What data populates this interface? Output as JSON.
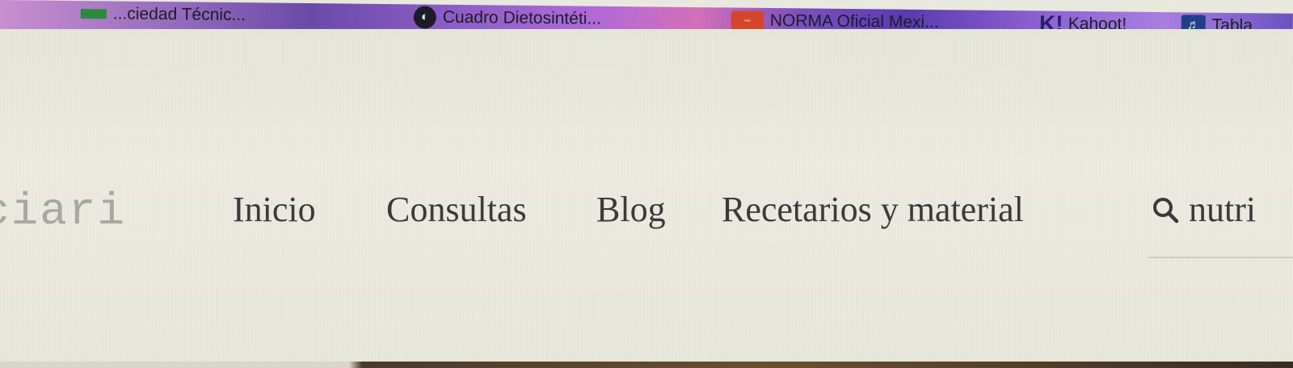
{
  "bookmarks": [
    {
      "label": "...ciedad Técnic...",
      "icon": "spreadsheet-icon"
    },
    {
      "label": "Cuadro Dietosintéti...",
      "icon": "circle-logo-icon"
    },
    {
      "label": "NORMA Oficial Mexi...",
      "icon": "norma-icon"
    },
    {
      "label": "Kahoot!",
      "icon": "kahoot-icon",
      "glyph": "K!"
    },
    {
      "label": "Tabla",
      "icon": "tabla-icon",
      "glyph": "♬"
    }
  ],
  "site": {
    "logo": "ciari",
    "nav": [
      "Inicio",
      "Consultas",
      "Blog",
      "Recetarios y material"
    ],
    "search": {
      "value": "nutri",
      "icon": "search-icon"
    }
  },
  "colors": {
    "page_background": "#e9e8de",
    "nav_text": "#3c3a36",
    "logo_text": "#a8a8a0"
  }
}
